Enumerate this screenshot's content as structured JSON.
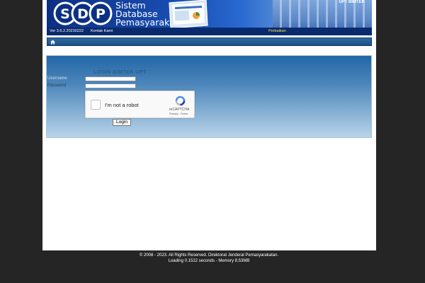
{
  "header": {
    "logo_letters": "SDP",
    "logo_line1": "Sistem",
    "logo_line2": "Database",
    "logo_line3": "Pemasyarakatan",
    "unit_label": "UPT BIMTEK",
    "version": "Ver 3.6.2.20230222",
    "kontak_link": "Kontak Kami",
    "perbaikan_link": "Perbaikan"
  },
  "navbar": {
    "home_icon": "home-icon"
  },
  "login": {
    "title": "LOGIN BIMTEK UPT",
    "username_label": "Username",
    "password_label": "Password",
    "username_value": "",
    "password_value": "",
    "recaptcha": {
      "checkbox_label": "I'm not a robot",
      "brand": "reCAPTCHA",
      "links": "Privacy - Terms"
    },
    "button_label": "Login"
  },
  "footer": {
    "copyright": "© 2008 - 2023. All Rights Reserved. Direktorat Jenderal Pemasyarakatan.",
    "loading": "Loading 0.1522 seconds - Memory 8.53MB"
  },
  "colors": {
    "page_bg": "#252525",
    "banner_dark": "#0a2a6e",
    "accent_yellow": "#f2e64a",
    "panel_top": "#2266a6",
    "panel_bottom": "#b9d3e7"
  }
}
